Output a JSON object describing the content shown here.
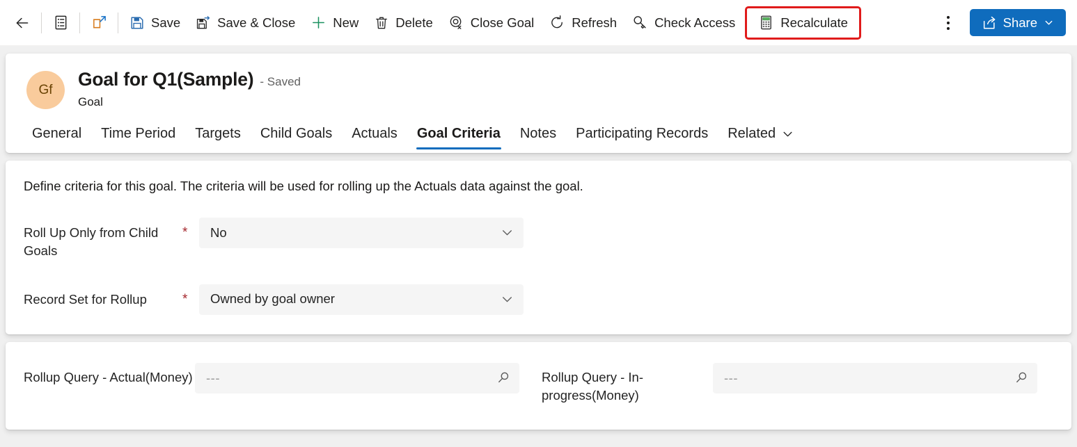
{
  "commandbar": {
    "back": {
      "label": "Back",
      "icon": "back-arrow-icon"
    },
    "form_selector": {
      "label": "Form selector",
      "icon": "form-list-icon"
    },
    "popout": {
      "label": "Open in new window",
      "icon": "pop-out-icon"
    },
    "buttons": [
      {
        "id": "save",
        "label": "Save",
        "icon": "save-icon"
      },
      {
        "id": "save-close",
        "label": "Save & Close",
        "icon": "save-and-close-icon"
      },
      {
        "id": "new",
        "label": "New",
        "icon": "plus-icon"
      },
      {
        "id": "delete",
        "label": "Delete",
        "icon": "trash-icon"
      },
      {
        "id": "close-goal",
        "label": "Close Goal",
        "icon": "close-goal-icon"
      },
      {
        "id": "refresh",
        "label": "Refresh",
        "icon": "refresh-icon"
      },
      {
        "id": "check-access",
        "label": "Check Access",
        "icon": "key-icon"
      },
      {
        "id": "recalculate",
        "label": "Recalculate",
        "icon": "calculator-icon",
        "highlighted": true
      }
    ],
    "overflow": {
      "label": "More commands",
      "icon": "kebab-menu-icon"
    },
    "share": {
      "label": "Share",
      "icon": "share-icon",
      "chevron": "chevron-down-icon"
    },
    "highlight_color": "#e01b1b",
    "accent_color": "#0f6cbd"
  },
  "record": {
    "avatar_initials": "Gf",
    "avatar_bg": "#f9cb9c",
    "title": "Goal for Q1(Sample)",
    "status": "- Saved",
    "entity": "Goal"
  },
  "tabs": {
    "items": [
      {
        "label": "General",
        "active": false
      },
      {
        "label": "Time Period",
        "active": false
      },
      {
        "label": "Targets",
        "active": false
      },
      {
        "label": "Child Goals",
        "active": false
      },
      {
        "label": "Actuals",
        "active": false
      },
      {
        "label": "Goal Criteria",
        "active": true
      },
      {
        "label": "Notes",
        "active": false
      },
      {
        "label": "Participating Records",
        "active": false
      }
    ],
    "related": {
      "label": "Related",
      "icon": "chevron-down-icon"
    }
  },
  "criteria": {
    "description": "Define criteria for this goal. The criteria will be used for rolling up the Actuals data against the goal.",
    "fields": [
      {
        "label": "Roll Up Only from Child Goals",
        "required": true,
        "required_marker": "*",
        "value": "No",
        "control": "dropdown",
        "icon": "chevron-down-icon"
      },
      {
        "label": "Record Set for Rollup",
        "required": true,
        "required_marker": "*",
        "value": "Owned by goal owner",
        "control": "dropdown",
        "icon": "chevron-down-icon"
      }
    ]
  },
  "rollup": {
    "fields": [
      {
        "label": "Rollup Query - Actual(Money)",
        "value": "---",
        "control": "lookup",
        "icon": "search-icon"
      },
      {
        "label": "Rollup Query - In-progress(Money)",
        "value": "---",
        "control": "lookup",
        "icon": "search-icon"
      }
    ]
  }
}
